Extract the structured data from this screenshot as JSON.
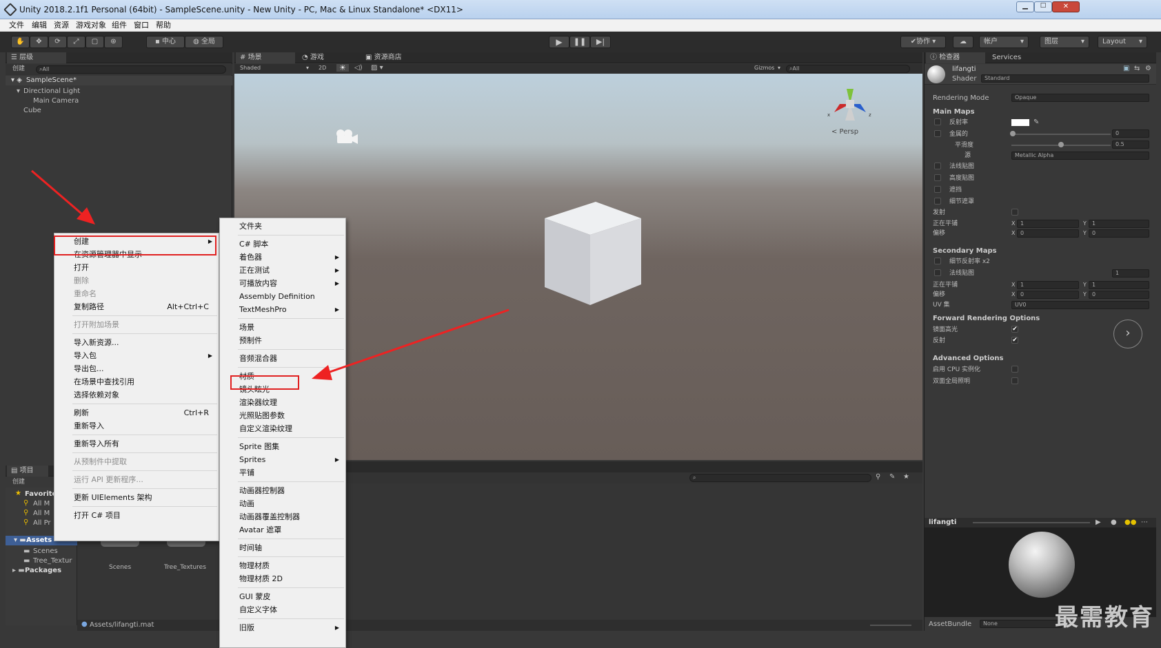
{
  "window": {
    "title": "Unity 2018.2.1f1 Personal (64bit) - SampleScene.unity - New Unity - PC, Mac & Linux Standalone* <DX11>"
  },
  "menubar": [
    "文件",
    "编辑",
    "资源",
    "游戏对象",
    "组件",
    "窗口",
    "帮助"
  ],
  "toolbar": {
    "pivot_label": "中心",
    "global_label": "全局",
    "collab_label": "协作",
    "account_label": "帐户",
    "layers_label": "图层",
    "layout_label": "Layout"
  },
  "hierarchy": {
    "tab": "层级",
    "create_label": "创建",
    "search_placeholder": "All",
    "scene": "SampleScene*",
    "items": [
      "Directional Light",
      "Main Camera",
      "Cube"
    ]
  },
  "scene_view": {
    "tabs": [
      "场景",
      "游戏",
      "资源商店"
    ],
    "shading": "Shaded",
    "mode_2d": "2D",
    "gizmos": "Gizmos",
    "search_placeholder": "All",
    "persp_label": "< Persp"
  },
  "project": {
    "tab": "项目",
    "create_label": "创建",
    "favorites_label": "Favorite",
    "favorites": [
      "All M",
      "All M",
      "All Pr"
    ],
    "assets_label": "Assets",
    "asset_children": [
      "Scenes",
      "Tree_Textur"
    ],
    "packages_label": "Packages",
    "folders": [
      "Scenes",
      "Tree_Textures"
    ],
    "footer_path": "Assets/lifangti.mat"
  },
  "context_menu": {
    "items": [
      {
        "label": "创建",
        "submenu": true,
        "highlight": true
      },
      {
        "label": "在资源管理器中显示"
      },
      {
        "label": "打开"
      },
      {
        "label": "删除",
        "disabled": true
      },
      {
        "label": "重命名",
        "disabled": true
      },
      {
        "label": "复制路径",
        "shortcut": "Alt+Ctrl+C"
      },
      {
        "sep": true
      },
      {
        "label": "打开附加场景",
        "disabled": true
      },
      {
        "sep": true
      },
      {
        "label": "导入新资源..."
      },
      {
        "label": "导入包",
        "submenu": true
      },
      {
        "label": "导出包..."
      },
      {
        "label": "在场景中查找引用"
      },
      {
        "label": "选择依赖对象"
      },
      {
        "sep": true
      },
      {
        "label": "刷新",
        "shortcut": "Ctrl+R"
      },
      {
        "label": "重新导入"
      },
      {
        "sep": true
      },
      {
        "label": "重新导入所有"
      },
      {
        "sep": true
      },
      {
        "label": "从预制件中提取",
        "disabled": true
      },
      {
        "sep": true
      },
      {
        "label": "运行 API 更新程序...",
        "disabled": true
      },
      {
        "sep": true
      },
      {
        "label": "更新 UIElements 架构"
      },
      {
        "sep": true
      },
      {
        "label": "打开 C# 项目"
      }
    ]
  },
  "create_submenu": {
    "items": [
      {
        "label": "文件夹"
      },
      {
        "sep": true
      },
      {
        "label": "C# 脚本"
      },
      {
        "label": "着色器",
        "submenu": true
      },
      {
        "label": "正在测试",
        "submenu": true
      },
      {
        "label": "可播放内容",
        "submenu": true
      },
      {
        "label": "Assembly Definition"
      },
      {
        "label": "TextMeshPro",
        "submenu": true
      },
      {
        "sep": true
      },
      {
        "label": "场景"
      },
      {
        "label": "预制件"
      },
      {
        "sep": true
      },
      {
        "label": "音频混合器"
      },
      {
        "sep": true
      },
      {
        "label": "材质",
        "highlight": true
      },
      {
        "label": "镜头眩光"
      },
      {
        "label": "渲染器纹理"
      },
      {
        "label": "光照贴图参数"
      },
      {
        "label": "自定义渲染纹理"
      },
      {
        "sep": true
      },
      {
        "label": "Sprite 图集"
      },
      {
        "label": "Sprites",
        "submenu": true
      },
      {
        "label": "平铺"
      },
      {
        "sep": true
      },
      {
        "label": "动画器控制器"
      },
      {
        "label": "动画"
      },
      {
        "label": "动画器覆盖控制器"
      },
      {
        "label": "Avatar 遮罩"
      },
      {
        "sep": true
      },
      {
        "label": "时间轴"
      },
      {
        "sep": true
      },
      {
        "label": "物理材质"
      },
      {
        "label": "物理材质 2D"
      },
      {
        "sep": true
      },
      {
        "label": "GUI 蒙皮"
      },
      {
        "label": "自定义字体"
      },
      {
        "sep": true
      },
      {
        "label": "旧版",
        "submenu": true
      }
    ]
  },
  "inspector": {
    "tabs": [
      "检查器",
      "Services"
    ],
    "material_name": "lifangti",
    "shader_label": "Shader",
    "shader_value": "Standard",
    "rendering_mode_label": "Rendering Mode",
    "rendering_mode_value": "Opaque",
    "main_maps_label": "Main Maps",
    "albedo": "反射率",
    "metallic": "金属的",
    "metallic_value": "0",
    "smoothness": "平滑度",
    "smoothness_value": "0.5",
    "source": "源",
    "source_value": "Metallic Alpha",
    "normal_map": "法线贴图",
    "height_map": "高度贴图",
    "occlusion": "遮挡",
    "detail_mask": "细节遮罩",
    "emission": "发射",
    "tiling": "正在平铺",
    "offset": "偏移",
    "tiling_x": "1",
    "tiling_y": "1",
    "offset_x": "0",
    "offset_y": "0",
    "secondary_maps_label": "Secondary Maps",
    "detail_albedo": "细节反射率 x2",
    "normal_map2": "法线贴图",
    "normal_map2_value": "1",
    "tiling2": "正在平铺",
    "offset2": "偏移",
    "tiling2_x": "1",
    "tiling2_y": "1",
    "offset2_x": "0",
    "offset2_y": "0",
    "uv_set": "UV 集",
    "uv_set_value": "UV0",
    "forward_label": "Forward Rendering Options",
    "specular": "镜面高光",
    "reflections": "反射",
    "advanced_label": "Advanced Options",
    "gpu_instancing": "启用 CPU 实例化",
    "double_sided_gi": "双面全局照明",
    "preview_name": "lifangti",
    "assetbundle_label": "AssetBundle",
    "assetbundle_value": "None",
    "axis_x": "X",
    "axis_y": "Y"
  },
  "watermark": "最需教育"
}
